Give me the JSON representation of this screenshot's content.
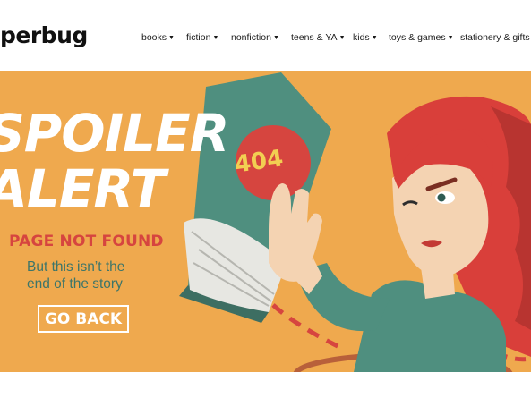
{
  "header": {
    "logo_text": "perbug",
    "nav": [
      {
        "label": "books"
      },
      {
        "label": "fiction"
      },
      {
        "label": "nonfiction"
      },
      {
        "label": "teens & YA"
      },
      {
        "label": "kids"
      },
      {
        "label": "toys & games"
      },
      {
        "label": "stationery & gifts"
      }
    ]
  },
  "hero": {
    "headline_line1": "SPOILER",
    "headline_line2": "ALERT",
    "error_title": "PAGE NOT FOUND",
    "subtitle_line1": "But this isn’t the",
    "subtitle_line2": "end of the story",
    "cta_label": "GO BACK",
    "book_badge": "404"
  },
  "colors": {
    "hero_background": "#efa94e",
    "book_cover": "#4f8f7f",
    "badge": "#d6453f",
    "badge_text": "#f2cf52",
    "hair": "#d93f3a",
    "skin": "#f4d3b2",
    "shirt": "#4f8f7f",
    "subtitle": "#3d7569",
    "error_title": "#d6453f"
  },
  "icons": [
    "chevron-down-icon"
  ]
}
